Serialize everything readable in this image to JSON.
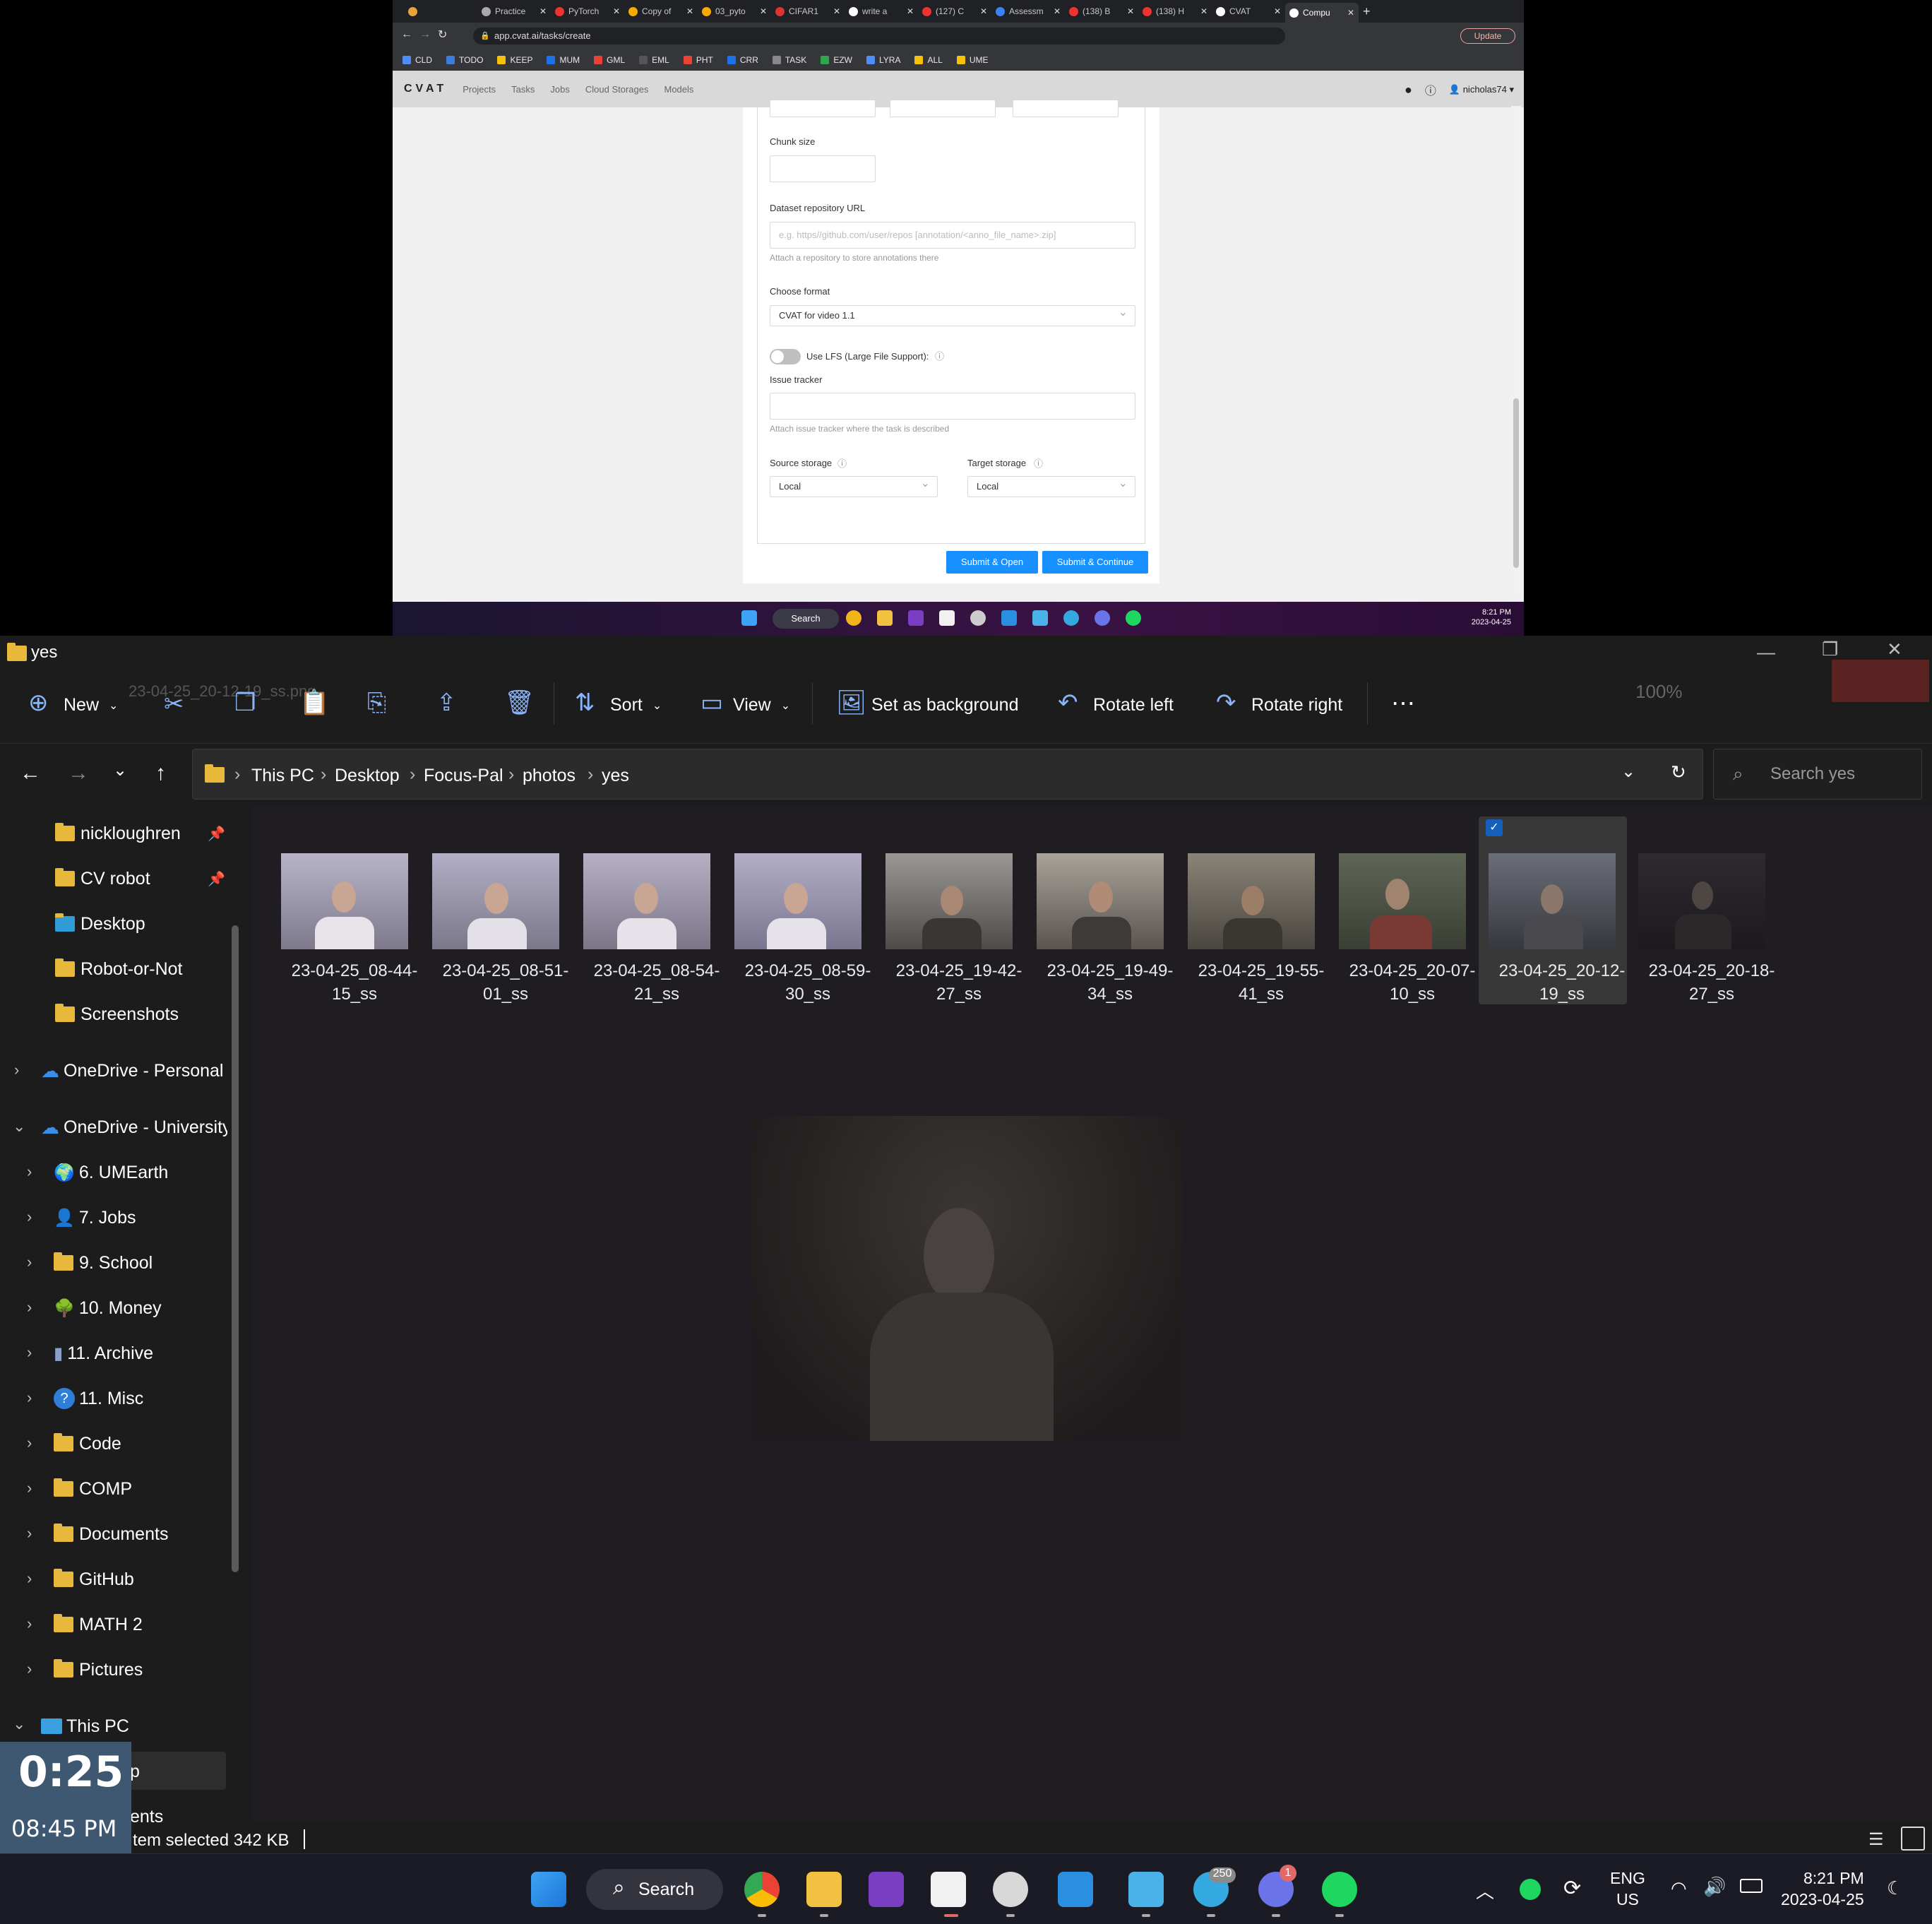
{
  "browser": {
    "tabs": [
      "Practice",
      "PyTorch",
      "Copy of",
      "03_pyto",
      "CIFAR1",
      "write a",
      "(127) C",
      "Assessm",
      "(138) B",
      "(138) H",
      "CVAT",
      "Compu"
    ],
    "url": "app.cvat.ai/tasks/create",
    "update_label": "Update",
    "bookmarks": [
      "CLD",
      "TODO",
      "KEEP",
      "MUM",
      "GML",
      "EML",
      "PHT",
      "CRR",
      "TASK",
      "EZW",
      "LYRA",
      "ALL",
      "UME"
    ]
  },
  "cvat": {
    "logo": "CVAT",
    "nav": [
      "Projects",
      "Tasks",
      "Jobs",
      "Cloud Storages",
      "Models"
    ],
    "user": "nicholas74",
    "chunk_size_label": "Chunk size",
    "dataset_repo_label": "Dataset repository URL",
    "dataset_repo_placeholder": "e.g. https//github.com/user/repos [annotation/<anno_file_name>.zip]",
    "dataset_repo_help": "Attach a repository to store annotations there",
    "choose_format_label": "Choose format",
    "format_value": "CVAT for video 1.1",
    "lfs_label": "Use LFS (Large File Support):",
    "issue_tracker_label": "Issue tracker",
    "issue_tracker_help": "Attach issue tracker where the task is described",
    "source_storage_label": "Source storage",
    "source_storage_value": "Local",
    "target_storage_label": "Target storage",
    "target_storage_value": "Local",
    "submit_open": "Submit & Open",
    "submit_continue": "Submit & Continue"
  },
  "small_taskbar": {
    "search": "Search",
    "time": "8:21 PM",
    "date": "2023-04-25"
  },
  "explorer": {
    "title": "yes",
    "ghost_filename": "23-04-25_20-12-19_ss.png",
    "zoom": "100%",
    "commands": {
      "new": "New",
      "sort": "Sort",
      "view": "View",
      "set_background": "Set as background",
      "rotate_left": "Rotate left",
      "rotate_right": "Rotate right"
    },
    "breadcrumb": [
      "This PC",
      "Desktop",
      "Focus-Pal",
      "photos",
      "yes"
    ],
    "search_placeholder": "Search yes",
    "sidebar": [
      "nickloughren",
      "CV robot",
      "Desktop",
      "Robot-or-Not",
      "Screenshots",
      "OneDrive - Personal",
      "OneDrive - University",
      "6. UMEarth",
      "7. Jobs",
      "9. School",
      "10. Money",
      "11. Archive",
      "11. Misc",
      "Code",
      "COMP",
      "Documents",
      "GitHub",
      "MATH 2",
      "Pictures",
      "This PC",
      "p",
      "ents"
    ],
    "files": [
      {
        "line1": "23-04-25_08-44-",
        "line2": "15_ss"
      },
      {
        "line1": "23-04-25_08-51-",
        "line2": "01_ss"
      },
      {
        "line1": "23-04-25_08-54-",
        "line2": "21_ss"
      },
      {
        "line1": "23-04-25_08-59-",
        "line2": "30_ss"
      },
      {
        "line1": "23-04-25_19-42-",
        "line2": "27_ss"
      },
      {
        "line1": "23-04-25_19-49-",
        "line2": "34_ss"
      },
      {
        "line1": "23-04-25_19-55-",
        "line2": "41_ss"
      },
      {
        "line1": "23-04-25_20-07-",
        "line2": "10_ss"
      },
      {
        "line1": "23-04-25_20-12-",
        "line2": "19_ss"
      },
      {
        "line1": "23-04-25_20-18-",
        "line2": "27_ss"
      }
    ],
    "status": "tem selected  342 KB"
  },
  "timer": {
    "countdown": "0:25",
    "clock": "08:45 PM"
  },
  "taskbar": {
    "search": "Search",
    "lang1": "ENG",
    "lang2": "US",
    "time": "8:21 PM",
    "date": "2023-04-25",
    "telegram_badge": "250",
    "discord_badge": "1"
  }
}
